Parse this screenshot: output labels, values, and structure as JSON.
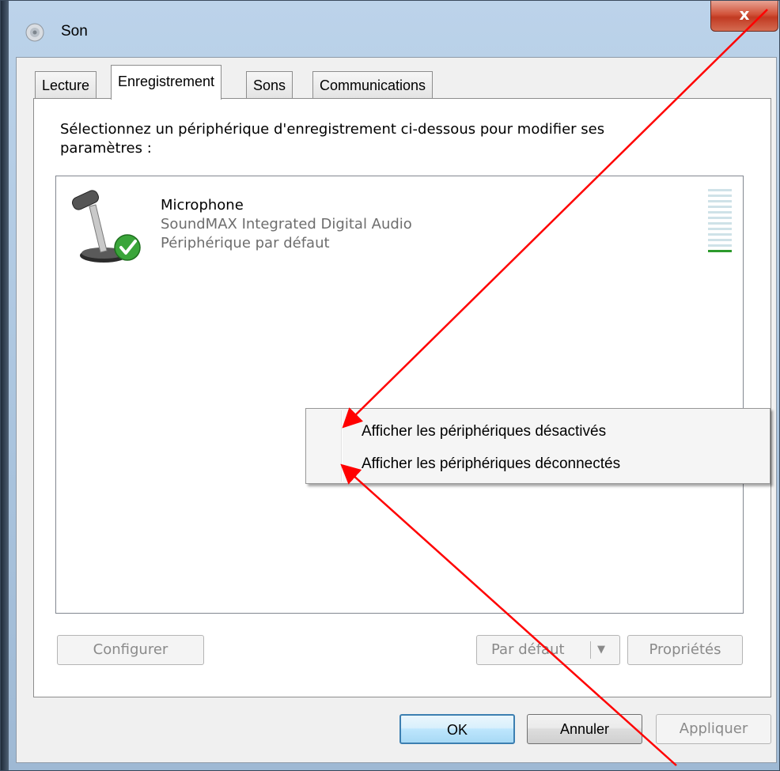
{
  "window": {
    "title": "Son",
    "close_label": "x"
  },
  "tabs": [
    {
      "label": "Lecture",
      "active": false
    },
    {
      "label": "Enregistrement",
      "active": true
    },
    {
      "label": "Sons",
      "active": false
    },
    {
      "label": "Communications",
      "active": false
    }
  ],
  "panel": {
    "instruction_line1": "Sélectionnez un périphérique d'enregistrement ci-dessous pour modifier ses",
    "instruction_line2": "paramètres :"
  },
  "devices": [
    {
      "name": "Microphone",
      "description": "SoundMAX Integrated Digital Audio",
      "status": "Périphérique par défaut",
      "icon": "microphone-icon",
      "status_icon": "checkmark-icon",
      "level_fraction": 0.1
    }
  ],
  "panel_buttons": {
    "configure": "Configurer",
    "set_default": "Par défaut",
    "properties": "Propriétés"
  },
  "context_menu": {
    "items": [
      {
        "label": "Afficher les périphériques désactivés"
      },
      {
        "label": "Afficher les périphériques déconnectés"
      }
    ]
  },
  "dialog_buttons": {
    "ok": "OK",
    "cancel": "Annuler",
    "apply": "Appliquer"
  },
  "colors": {
    "annotation_arrow": "#ff0000",
    "level_active": "#2d9a2d",
    "level_inactive": "#cfe2e8",
    "check_green": "#3aa53a"
  }
}
